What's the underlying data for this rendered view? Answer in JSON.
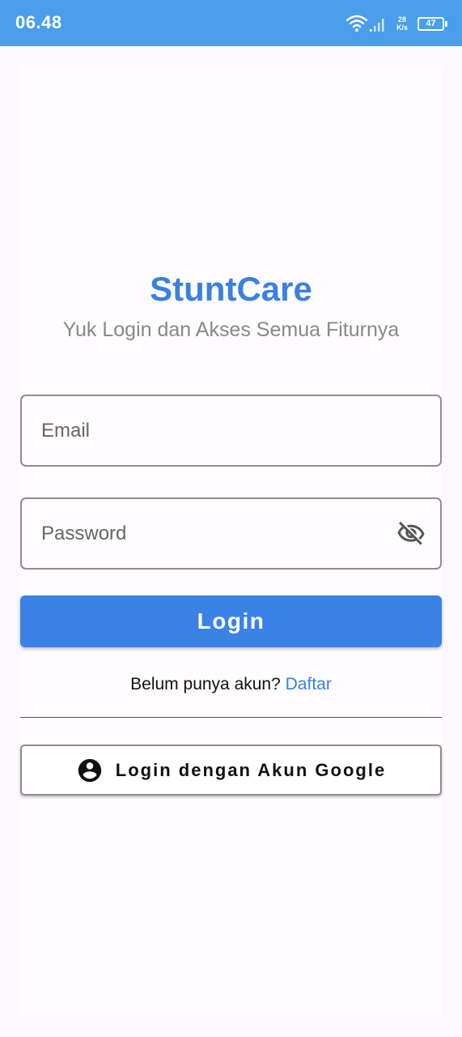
{
  "status_bar": {
    "time": "06.48",
    "net_speed_value": "28",
    "net_speed_unit": "K/s",
    "battery_level": "47",
    "icons": [
      "wifi-icon",
      "signal-icon",
      "battery-icon"
    ]
  },
  "header": {
    "title": "StuntCare",
    "subtitle": "Yuk Login dan Akses Semua Fiturnya"
  },
  "form": {
    "email_placeholder": "Email",
    "email_value": "",
    "password_placeholder": "Password",
    "password_value": "",
    "password_toggle_icon": "eye-off-icon",
    "login_label": "Login"
  },
  "register": {
    "prompt": "Belum punya akun?",
    "link_label": "Daftar"
  },
  "google": {
    "label": "Login dengan Akun Google",
    "icon": "account-circle-icon"
  },
  "colors": {
    "status_bar": "#4a9eea",
    "accent": "#3a80e2",
    "button": "#3b82e6",
    "subtitle": "#888888"
  }
}
